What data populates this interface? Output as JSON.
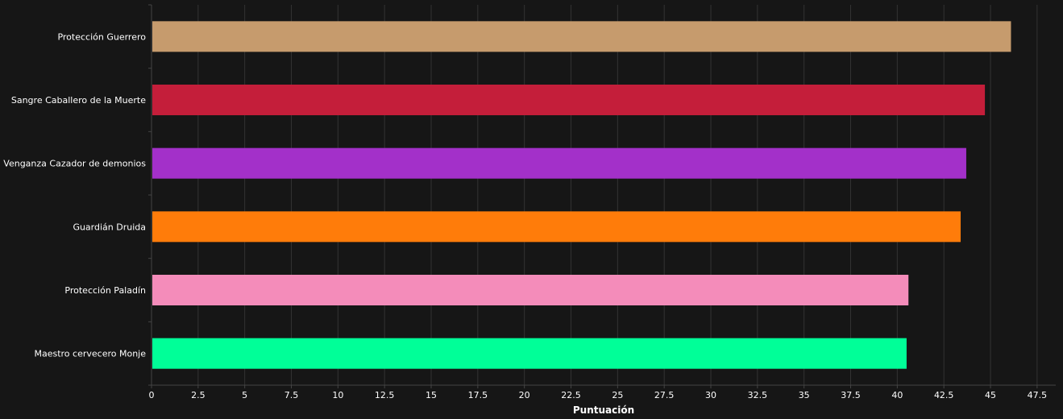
{
  "chart_data": {
    "type": "bar",
    "orientation": "horizontal",
    "categories": [
      "Protección Guerrero",
      "Sangre Caballero de la Muerte",
      "Venganza Cazador de demonios",
      "Guardián Druida",
      "Protección Paladín",
      "Maestro cervecero Monje"
    ],
    "values": [
      46.1,
      44.7,
      43.7,
      43.4,
      40.6,
      40.5
    ],
    "colors": [
      "#c69b6d",
      "#c41e3a",
      "#a330c9",
      "#ff7c0a",
      "#f48cba",
      "#00ff98"
    ],
    "xlabel": "Puntuación",
    "ylabel": "",
    "title": "",
    "xlim": [
      0,
      48.5
    ],
    "x_ticks": [
      "0",
      "2.5",
      "5",
      "7.5",
      "10",
      "12.5",
      "15",
      "17.5",
      "20",
      "22.5",
      "25",
      "27.5",
      "30",
      "32.5",
      "35",
      "37.5",
      "40",
      "42.5",
      "45",
      "47.5"
    ],
    "x_tick_values": [
      0,
      2.5,
      5,
      7.5,
      10,
      12.5,
      15,
      17.5,
      20,
      22.5,
      25,
      27.5,
      30,
      32.5,
      35,
      37.5,
      40,
      42.5,
      45,
      47.5
    ],
    "grid": "vertical",
    "legend": "none",
    "background": "#161616",
    "grid_color": "#333333",
    "axis_color": "#444444",
    "text_color": "#ffffff"
  }
}
